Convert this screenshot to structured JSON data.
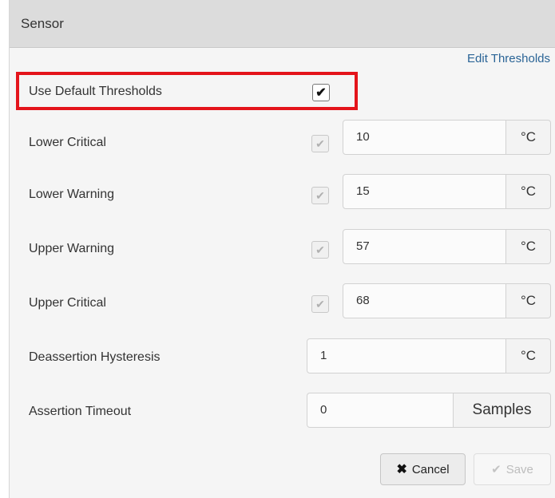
{
  "header": {
    "title": "Sensor"
  },
  "edit_thresholds_label": "Edit Thresholds",
  "use_default": {
    "label": "Use Default Thresholds",
    "checked": true
  },
  "thresholds": [
    {
      "label": "Lower Critical",
      "value": "10",
      "unit": "°C"
    },
    {
      "label": "Lower Warning",
      "value": "15",
      "unit": "°C"
    },
    {
      "label": "Upper Warning",
      "value": "57",
      "unit": "°C"
    },
    {
      "label": "Upper Critical",
      "value": "68",
      "unit": "°C"
    }
  ],
  "hysteresis": {
    "label": "Deassertion Hysteresis",
    "value": "1",
    "unit": "°C"
  },
  "timeout": {
    "label": "Assertion Timeout",
    "value": "0",
    "unit": "Samples"
  },
  "buttons": {
    "cancel": "Cancel",
    "save": "Save"
  },
  "colors": {
    "highlight": "#e4141b",
    "link": "#2a6496",
    "header_bg": "#dcdcdc"
  },
  "icons": {
    "cancel": "x-icon",
    "save": "check-icon",
    "checkbox": "checkmark-icon"
  }
}
